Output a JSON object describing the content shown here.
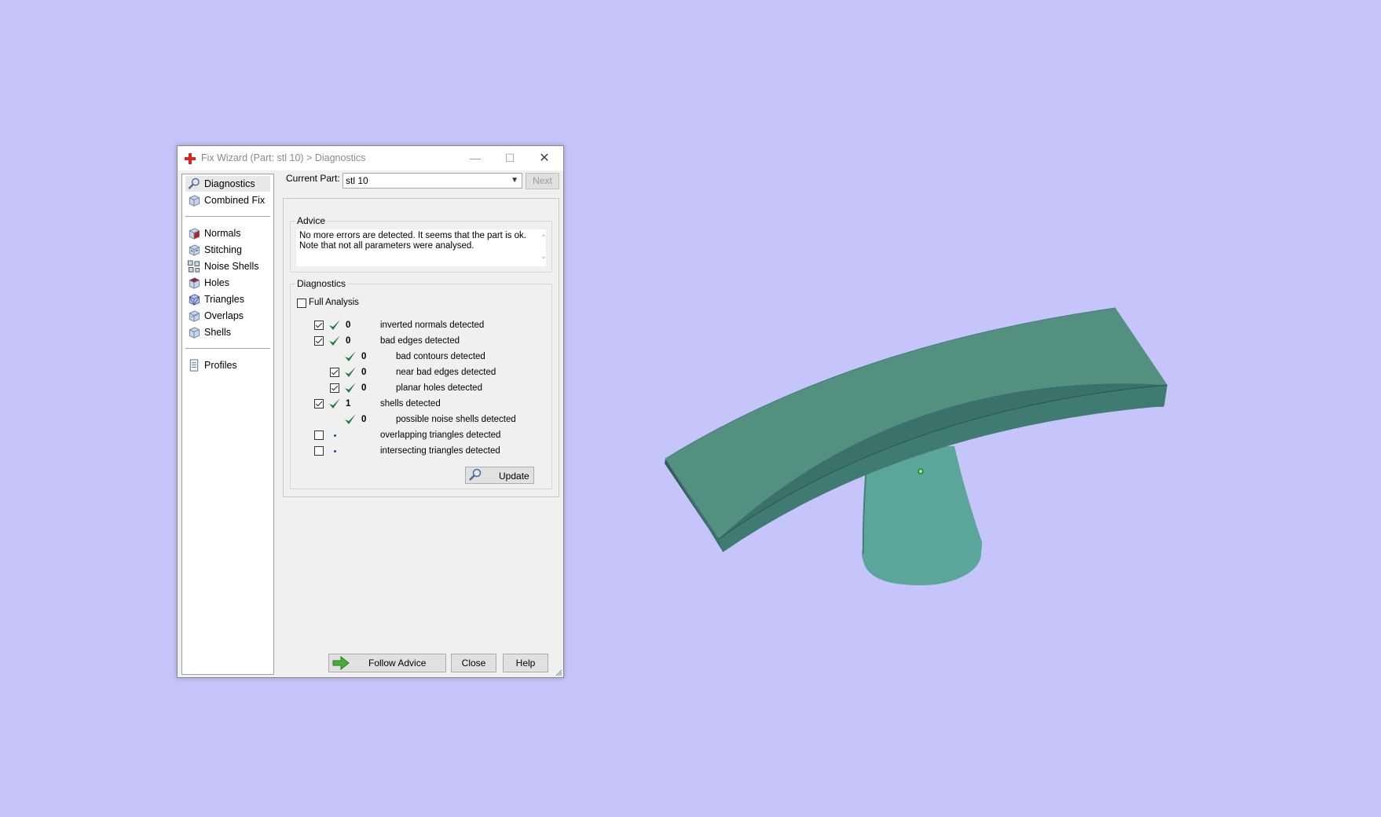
{
  "dialog": {
    "title": "Fix Wizard (Part: stl 10) > Diagnostics",
    "minimize": "—",
    "maximize": "☐",
    "close": "✕"
  },
  "nav": {
    "items": [
      {
        "label": "Diagnostics",
        "icon": "magnifier-icon"
      },
      {
        "label": "Combined Fix",
        "icon": "cube-icon"
      },
      {
        "label": "Normals",
        "icon": "normals-cube-icon"
      },
      {
        "label": "Stitching",
        "icon": "stitching-cube-icon"
      },
      {
        "label": "Noise Shells",
        "icon": "noise-shells-icon"
      },
      {
        "label": "Holes",
        "icon": "holes-cube-icon"
      },
      {
        "label": "Triangles",
        "icon": "triangles-cube-icon"
      },
      {
        "label": "Overlaps",
        "icon": "overlaps-cube-icon"
      },
      {
        "label": "Shells",
        "icon": "shells-cube-icon"
      },
      {
        "label": "Profiles",
        "icon": "document-icon"
      }
    ]
  },
  "current_part": {
    "label": "Current Part:",
    "value": "stl 10"
  },
  "next_label": "Next",
  "advice": {
    "title": "Advice",
    "line1": "No more errors are detected. It seems that the part is ok.",
    "line2": "Note that not all parameters were analysed."
  },
  "diagnostics": {
    "title": "Diagnostics",
    "full_analysis": "Full Analysis",
    "rows": [
      {
        "value": "0",
        "label": "inverted normals detected"
      },
      {
        "value": "0",
        "label": "bad edges detected"
      },
      {
        "value": "0",
        "label": "bad contours detected"
      },
      {
        "value": "0",
        "label": "near bad edges detected"
      },
      {
        "value": "0",
        "label": "planar holes detected"
      },
      {
        "value": "1",
        "label": "shells detected"
      },
      {
        "value": "0",
        "label": "possible noise shells detected"
      },
      {
        "value": "",
        "label": "overlapping triangles detected"
      },
      {
        "value": "",
        "label": "intersecting triangles detected"
      }
    ],
    "update_label": "Update"
  },
  "buttons": {
    "follow_advice": "Follow Advice",
    "close": "Close",
    "help": "Help"
  },
  "colors": {
    "background": "#c6c5fb",
    "model_top": "#54908a",
    "model_side": "#3f7a73",
    "check_green": "#1f7a3a"
  }
}
